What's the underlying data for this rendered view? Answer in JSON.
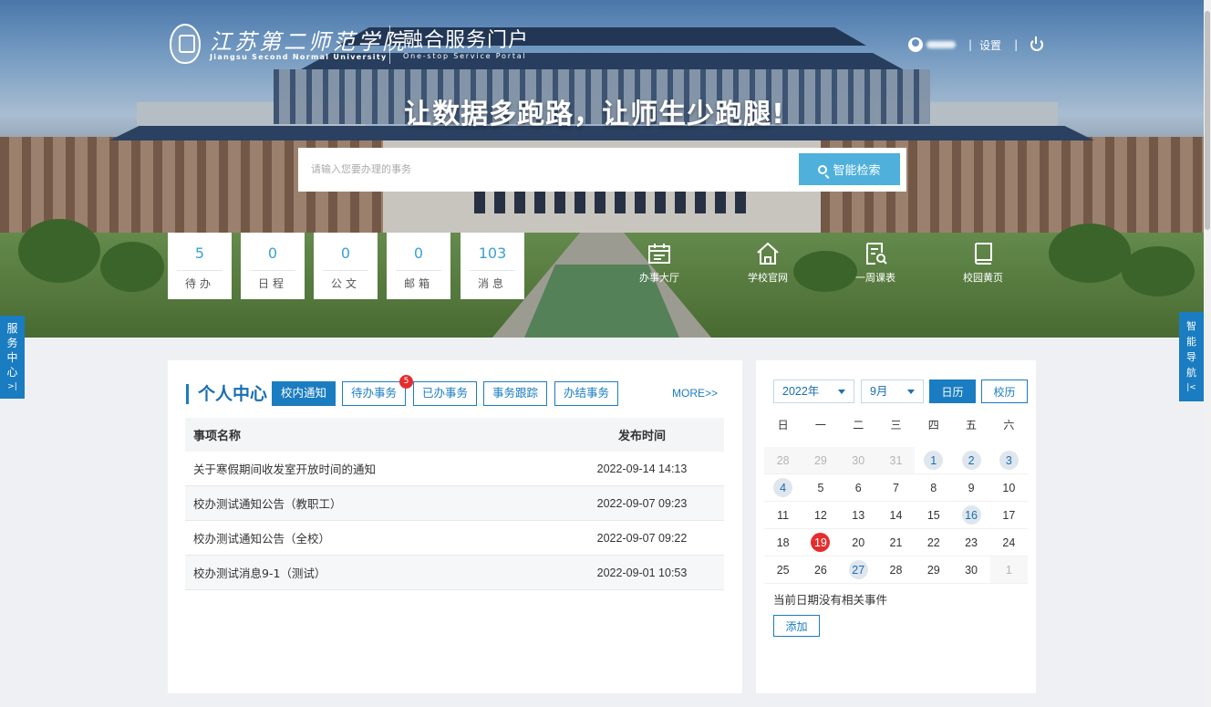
{
  "header": {
    "school_name_cn": "江苏第二师范学院",
    "school_name_en": "Jiangsu Second Normal University",
    "portal_name_cn": "融合服务门户",
    "portal_name_en": "One-stop Service Portal",
    "user_icon": "avatar-icon",
    "separator": "|",
    "settings_label": "设置",
    "logout_icon": "power-icon"
  },
  "hero": {
    "slogan": "让数据多跑路，让师生少跑腿!"
  },
  "search": {
    "placeholder": "请输入您要办理的事务",
    "button_label": "智能检索",
    "button_icon": "search-icon"
  },
  "stats": [
    {
      "value": "5",
      "label": "待办"
    },
    {
      "value": "0",
      "label": "日程"
    },
    {
      "value": "0",
      "label": "公文"
    },
    {
      "value": "0",
      "label": "邮箱"
    },
    {
      "value": "103",
      "label": "消息"
    }
  ],
  "quick_links": [
    {
      "label": "办事大厅",
      "icon": "service-hall-icon"
    },
    {
      "label": "学校官网",
      "icon": "home-icon"
    },
    {
      "label": "一周课表",
      "icon": "schedule-icon"
    },
    {
      "label": "校园黄页",
      "icon": "book-icon"
    }
  ],
  "side_tabs": {
    "left": [
      "服",
      "务",
      "中",
      "心",
      ">|"
    ],
    "right": [
      "智",
      "能",
      "导",
      "航",
      "|<"
    ]
  },
  "personal_center": {
    "title": "个人中心",
    "tabs": [
      {
        "label": "校内通知",
        "active": true
      },
      {
        "label": "待办事务",
        "active": false,
        "badge": "5"
      },
      {
        "label": "已办事务",
        "active": false
      },
      {
        "label": "事务跟踪",
        "active": false
      },
      {
        "label": "办结事务",
        "active": false
      }
    ],
    "more_label": "MORE>>",
    "columns": [
      "事项名称",
      "发布时间"
    ],
    "rows": [
      {
        "name": "关于寒假期间收发室开放时间的通知",
        "time": "2022-09-14 14:13"
      },
      {
        "name": "校办测试通知公告（教职工）",
        "time": "2022-09-07 09:23"
      },
      {
        "name": "校办测试通知公告（全校）",
        "time": "2022-09-07 09:22"
      },
      {
        "name": "校办测试消息9-1（测试）",
        "time": "2022-09-01 10:53"
      }
    ]
  },
  "calendar": {
    "year_select": "2022年",
    "month_select": "9月",
    "buttons": [
      {
        "label": "日历",
        "active": true
      },
      {
        "label": "校历",
        "active": false
      }
    ],
    "weekdays": [
      "日",
      "一",
      "二",
      "三",
      "四",
      "五",
      "六"
    ],
    "weeks": [
      [
        {
          "d": "28",
          "other": true
        },
        {
          "d": "29",
          "other": true
        },
        {
          "d": "30",
          "other": true
        },
        {
          "d": "31",
          "other": true
        },
        {
          "d": "1",
          "event": true
        },
        {
          "d": "2",
          "event": true
        },
        {
          "d": "3",
          "event": true
        }
      ],
      [
        {
          "d": "4",
          "event": true
        },
        {
          "d": "5"
        },
        {
          "d": "6"
        },
        {
          "d": "7"
        },
        {
          "d": "8"
        },
        {
          "d": "9"
        },
        {
          "d": "10"
        }
      ],
      [
        {
          "d": "11"
        },
        {
          "d": "12"
        },
        {
          "d": "13"
        },
        {
          "d": "14"
        },
        {
          "d": "15"
        },
        {
          "d": "16",
          "event": true
        },
        {
          "d": "17"
        }
      ],
      [
        {
          "d": "18"
        },
        {
          "d": "19",
          "today": true
        },
        {
          "d": "20"
        },
        {
          "d": "21"
        },
        {
          "d": "22"
        },
        {
          "d": "23"
        },
        {
          "d": "24"
        }
      ],
      [
        {
          "d": "25"
        },
        {
          "d": "26"
        },
        {
          "d": "27",
          "event": true
        },
        {
          "d": "28"
        },
        {
          "d": "29"
        },
        {
          "d": "30"
        },
        {
          "d": "1",
          "other": true
        }
      ]
    ],
    "no_event_text": "当前日期没有相关事件",
    "add_label": "添加"
  }
}
